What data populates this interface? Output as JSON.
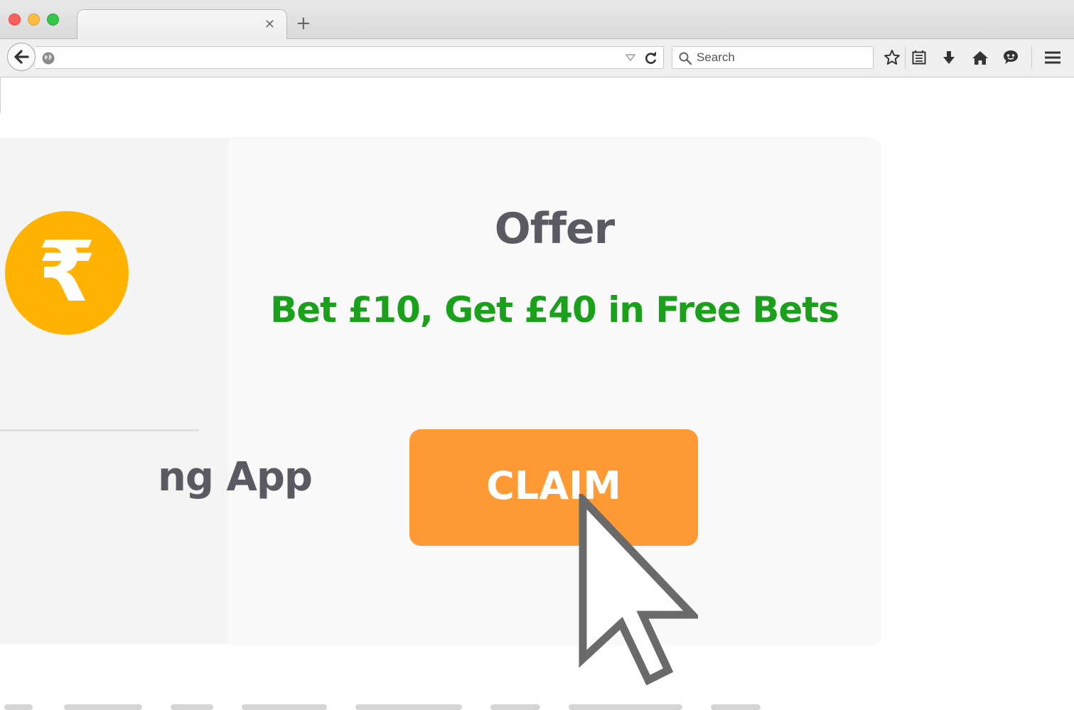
{
  "browser": {
    "tab": {
      "title": "",
      "close_icon": "close-icon"
    },
    "new_tab_label": "+",
    "url": "",
    "search": {
      "placeholder": "Search"
    },
    "toolbar_icons": [
      "star-icon",
      "reading-list-icon",
      "download-icon",
      "home-icon",
      "chat-icon",
      "menu-icon"
    ],
    "colors": {
      "close": "#fc605c",
      "minimize": "#fdbc40",
      "maximize": "#34c84a"
    }
  },
  "page": {
    "left_panel": {
      "coin_icon": "rupee-icon",
      "coin_symbol": "₹",
      "coin_color": "#ffb300",
      "app_label": "ng App"
    },
    "offer": {
      "title": "Offer",
      "text": "Bet £10, Get £40 in Free Bets",
      "text_color": "#1aa01a",
      "claim_label": "CLAIM",
      "claim_color": "#ff9933"
    },
    "cursor_icon": "pointer-cursor-icon"
  }
}
